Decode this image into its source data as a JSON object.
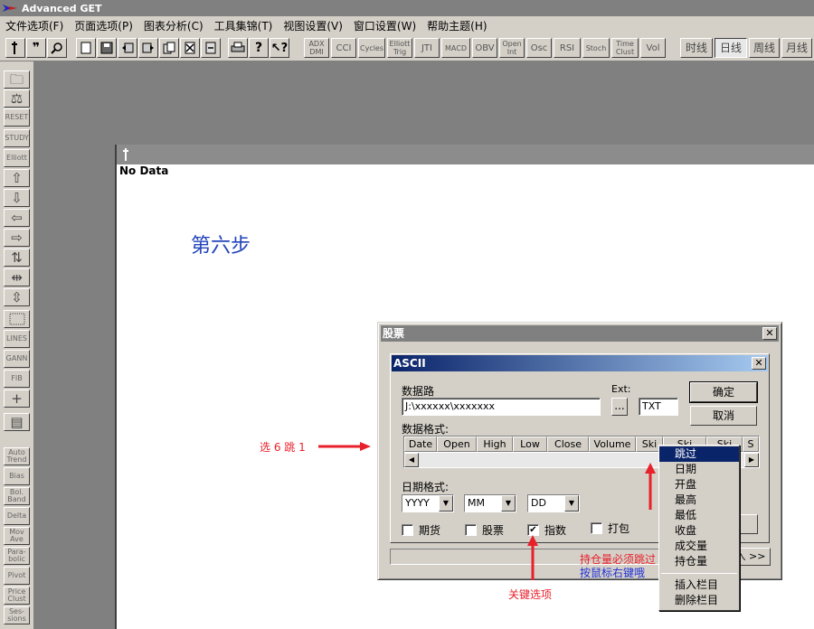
{
  "app": {
    "title": "Advanced GET"
  },
  "menu": [
    "文件选项(F)",
    "页面选项(P)",
    "图表分析(C)",
    "工具集锦(T)",
    "视图设置(V)",
    "窗口设置(W)",
    "帮助主题(H)"
  ],
  "toolbar": {
    "indicators": [
      "ADX DMI",
      "CCI",
      "Cycles",
      "Elliott Trig",
      "JTI",
      "MACD",
      "OBV",
      "Open Int",
      "Osc",
      "RSI",
      "Stoch",
      "Time Clust",
      "Vol"
    ],
    "periods": [
      "时线",
      "日线",
      "周线",
      "月线"
    ]
  },
  "sidebar": {
    "labels": [
      "RESET",
      "STUDY",
      "Elliott",
      "LINES",
      "GANN",
      "FIB",
      "Auto Trend",
      "Bias",
      "Bol. Band",
      "Delta",
      "Mov Ave",
      "Para-bolic",
      "Pivot",
      "Price Clust",
      "Ses-sions"
    ]
  },
  "chart": {
    "nodata": "No Data",
    "step": "第六步"
  },
  "dialog": {
    "title": "股票",
    "inner_title": "ASCII",
    "path_label": "数据路",
    "path_value": "J:\\xxxxxx\\xxxxxxx",
    "ext_label": "Ext:",
    "browse": "...",
    "ext_value": "TXT",
    "ok": "确定",
    "cancel": "取消",
    "format_label": "数据格式:",
    "columns": [
      "Date",
      "Open",
      "High",
      "Low",
      "Close",
      "Volume",
      "Ski",
      "Ski",
      "S"
    ],
    "date_format_label": "日期格式:",
    "year": "YYYY",
    "month": "MM",
    "day": "DD",
    "chk_futures": "期货",
    "chk_stock": "股票",
    "chk_index": "指数",
    "chk_pack": "打包",
    "index_checked": "✔",
    "import_btn": "入 >>"
  },
  "context_menu": [
    "跳过",
    "日期",
    "开盘",
    "最高",
    "最低",
    "收盘",
    "成交量",
    "持仓量",
    "插入栏目",
    "删除栏目"
  ],
  "annotations": {
    "select_col": "选 6 跳 1",
    "oi_skip": "持仓量必须跳过",
    "right_click": "按鼠标右键哦",
    "key_option": "关键选项"
  },
  "colors": {
    "red": "#e8202a",
    "blue": "#1f2fd6",
    "selection": "#0a246a"
  }
}
